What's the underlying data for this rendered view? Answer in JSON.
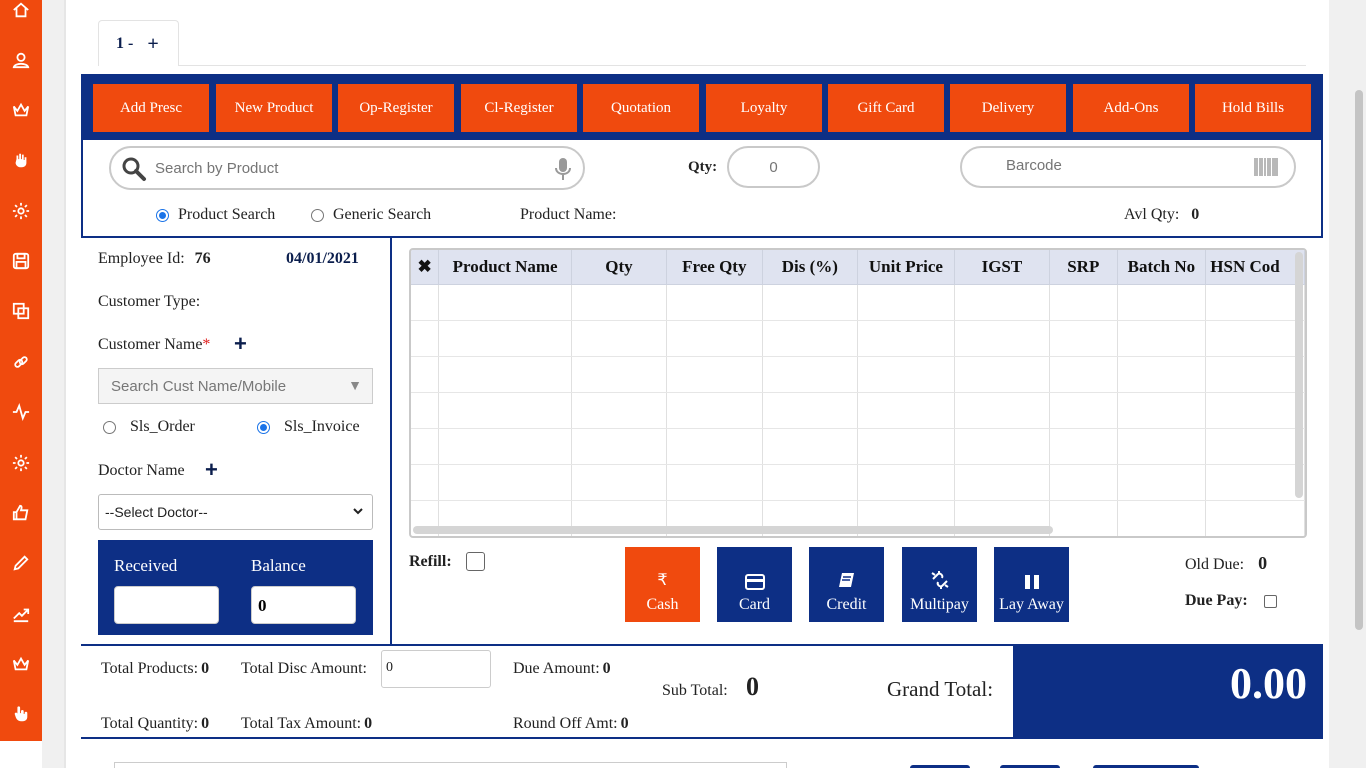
{
  "tab": {
    "label": "1 -",
    "add_symbol": "+"
  },
  "actions": [
    "Add Presc",
    "New Product",
    "Op-Register",
    "Cl-Register",
    "Quotation",
    "Loyalty",
    "Gift Card",
    "Delivery",
    "Add-Ons",
    "Hold Bills"
  ],
  "search": {
    "placeholder": "Search by Product",
    "qty_label": "Qty:",
    "qty_value": "0",
    "barcode_placeholder": "Barcode"
  },
  "search_modes": {
    "product": "Product Search",
    "generic": "Generic Search",
    "selected": "product"
  },
  "product_name_label": "Product Name:",
  "avl_qty": {
    "label": "Avl Qty:",
    "value": "0"
  },
  "customer": {
    "employee_label": "Employee Id:",
    "employee_id": "76",
    "date": "04/01/2021",
    "customer_type_label": "Customer Type:",
    "customer_name_label": "Customer Name",
    "required_mark": "*",
    "search_placeholder": "Search Cust Name/Mobile",
    "order_types": [
      "Sls_Order",
      "Sls_Invoice"
    ],
    "selected_order_type": "Sls_Invoice",
    "doctor_label": "Doctor Name",
    "doctor_select": "--Select Doctor--",
    "received_label": "Received",
    "received_value": "",
    "balance_label": "Balance",
    "balance_value": "0"
  },
  "grid": {
    "columns": [
      "Product Name",
      "Qty",
      "Free Qty",
      "Dis (%)",
      "Unit Price",
      "IGST",
      "SRP",
      "Batch No",
      "HSN Cod"
    ],
    "rows": []
  },
  "refill_label": "Refill:",
  "payments": [
    "Cash",
    "Card",
    "Credit",
    "Multipay",
    "Lay Away"
  ],
  "active_payment": "Cash",
  "currency_symbol": "₹",
  "old_due": {
    "label": "Old Due:",
    "value": "0"
  },
  "due_pay_label": "Due Pay:",
  "totals": {
    "total_products_label": "Total Products:",
    "total_products": "0",
    "total_quantity_label": "Total Quantity:",
    "total_quantity": "0",
    "total_disc_label": "Total Disc Amount:",
    "total_disc_value": "0",
    "total_tax_label": "Total Tax Amount:",
    "total_tax": "0",
    "due_amount_label": "Due Amount:",
    "due_amount": "0",
    "round_off_label": "Round Off Amt:",
    "round_off": "0",
    "sub_total_label": "Sub Total:",
    "sub_total": "0",
    "grand_total_label": "Grand Total:",
    "grand_total": "0.00"
  },
  "colors": {
    "accent_orange": "#f04a0e",
    "navy": "#0d2f85",
    "grid_header": "#dfe3f0"
  },
  "sidebar_icons": [
    "home-icon",
    "user-icon",
    "crown-icon",
    "hand-icon",
    "settings-icon",
    "save-icon",
    "copy-icon",
    "link-icon",
    "pulse-icon",
    "settings-icon",
    "thumbs-up-icon",
    "pencil-icon",
    "trend-icon",
    "crown-icon",
    "hand-point-icon"
  ]
}
